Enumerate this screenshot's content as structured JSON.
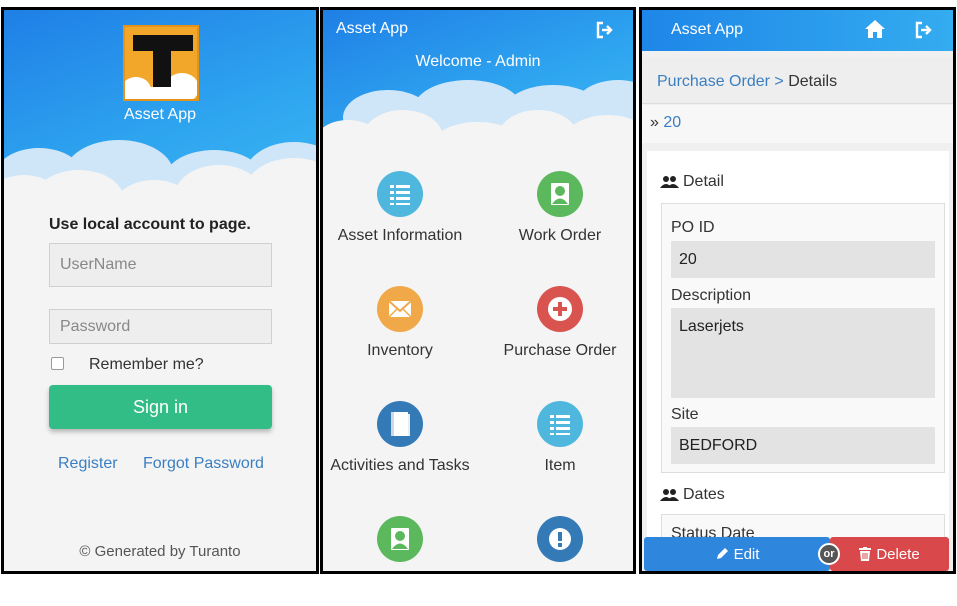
{
  "login": {
    "app_name": "Asset App",
    "heading": "Use local account to page.",
    "username_placeholder": "UserName",
    "password_placeholder": "Password",
    "remember_label": "Remember me?",
    "signin_label": "Sign in",
    "register_label": "Register",
    "forgot_label": "Forgot Password",
    "footer": "© Generated by Turanto",
    "icons": {
      "logo": "app-logo-t",
      "checkbox": "checkbox-unchecked"
    }
  },
  "menu": {
    "app_title": "Asset App",
    "welcome": "Welcome - Admin",
    "items": [
      {
        "label": "Asset Information",
        "icon": "list-icon",
        "color": "#4fb7de"
      },
      {
        "label": "Work Order",
        "icon": "user-icon",
        "color": "#5cb85c"
      },
      {
        "label": "Inventory",
        "icon": "envelope-icon",
        "color": "#f0a848"
      },
      {
        "label": "Purchase Order",
        "icon": "plus-icon",
        "color": "#d9534f"
      },
      {
        "label": "Activities and Tasks",
        "icon": "book-icon",
        "color": "#337ab7"
      },
      {
        "label": "Item",
        "icon": "list-icon",
        "color": "#4fb7de"
      },
      {
        "label": "",
        "icon": "user-icon",
        "color": "#5cb85c"
      },
      {
        "label": "",
        "icon": "exclamation-icon",
        "color": "#337ab7"
      }
    ]
  },
  "detail": {
    "app_title": "Asset App",
    "breadcrumb": {
      "parent": "Purchase Order",
      "separator": ">",
      "current": "Details"
    },
    "record_prefix": "»",
    "record_id": "20",
    "section_detail": "Detail",
    "fields": {
      "po_id_label": "PO ID",
      "po_id_value": "20",
      "description_label": "Description",
      "description_value": "Laserjets",
      "site_label": "Site",
      "site_value": "BEDFORD"
    },
    "section_dates": "Dates",
    "status_date_label": "Status Date",
    "edit_label": "Edit",
    "or_label": "or",
    "delete_label": "Delete"
  },
  "colors": {
    "header_blue": "#2ea4ef",
    "signin_green": "#32bd86",
    "link_blue": "#3a7fc1",
    "edit_blue": "#2f86dd",
    "delete_red": "#d9484a"
  }
}
